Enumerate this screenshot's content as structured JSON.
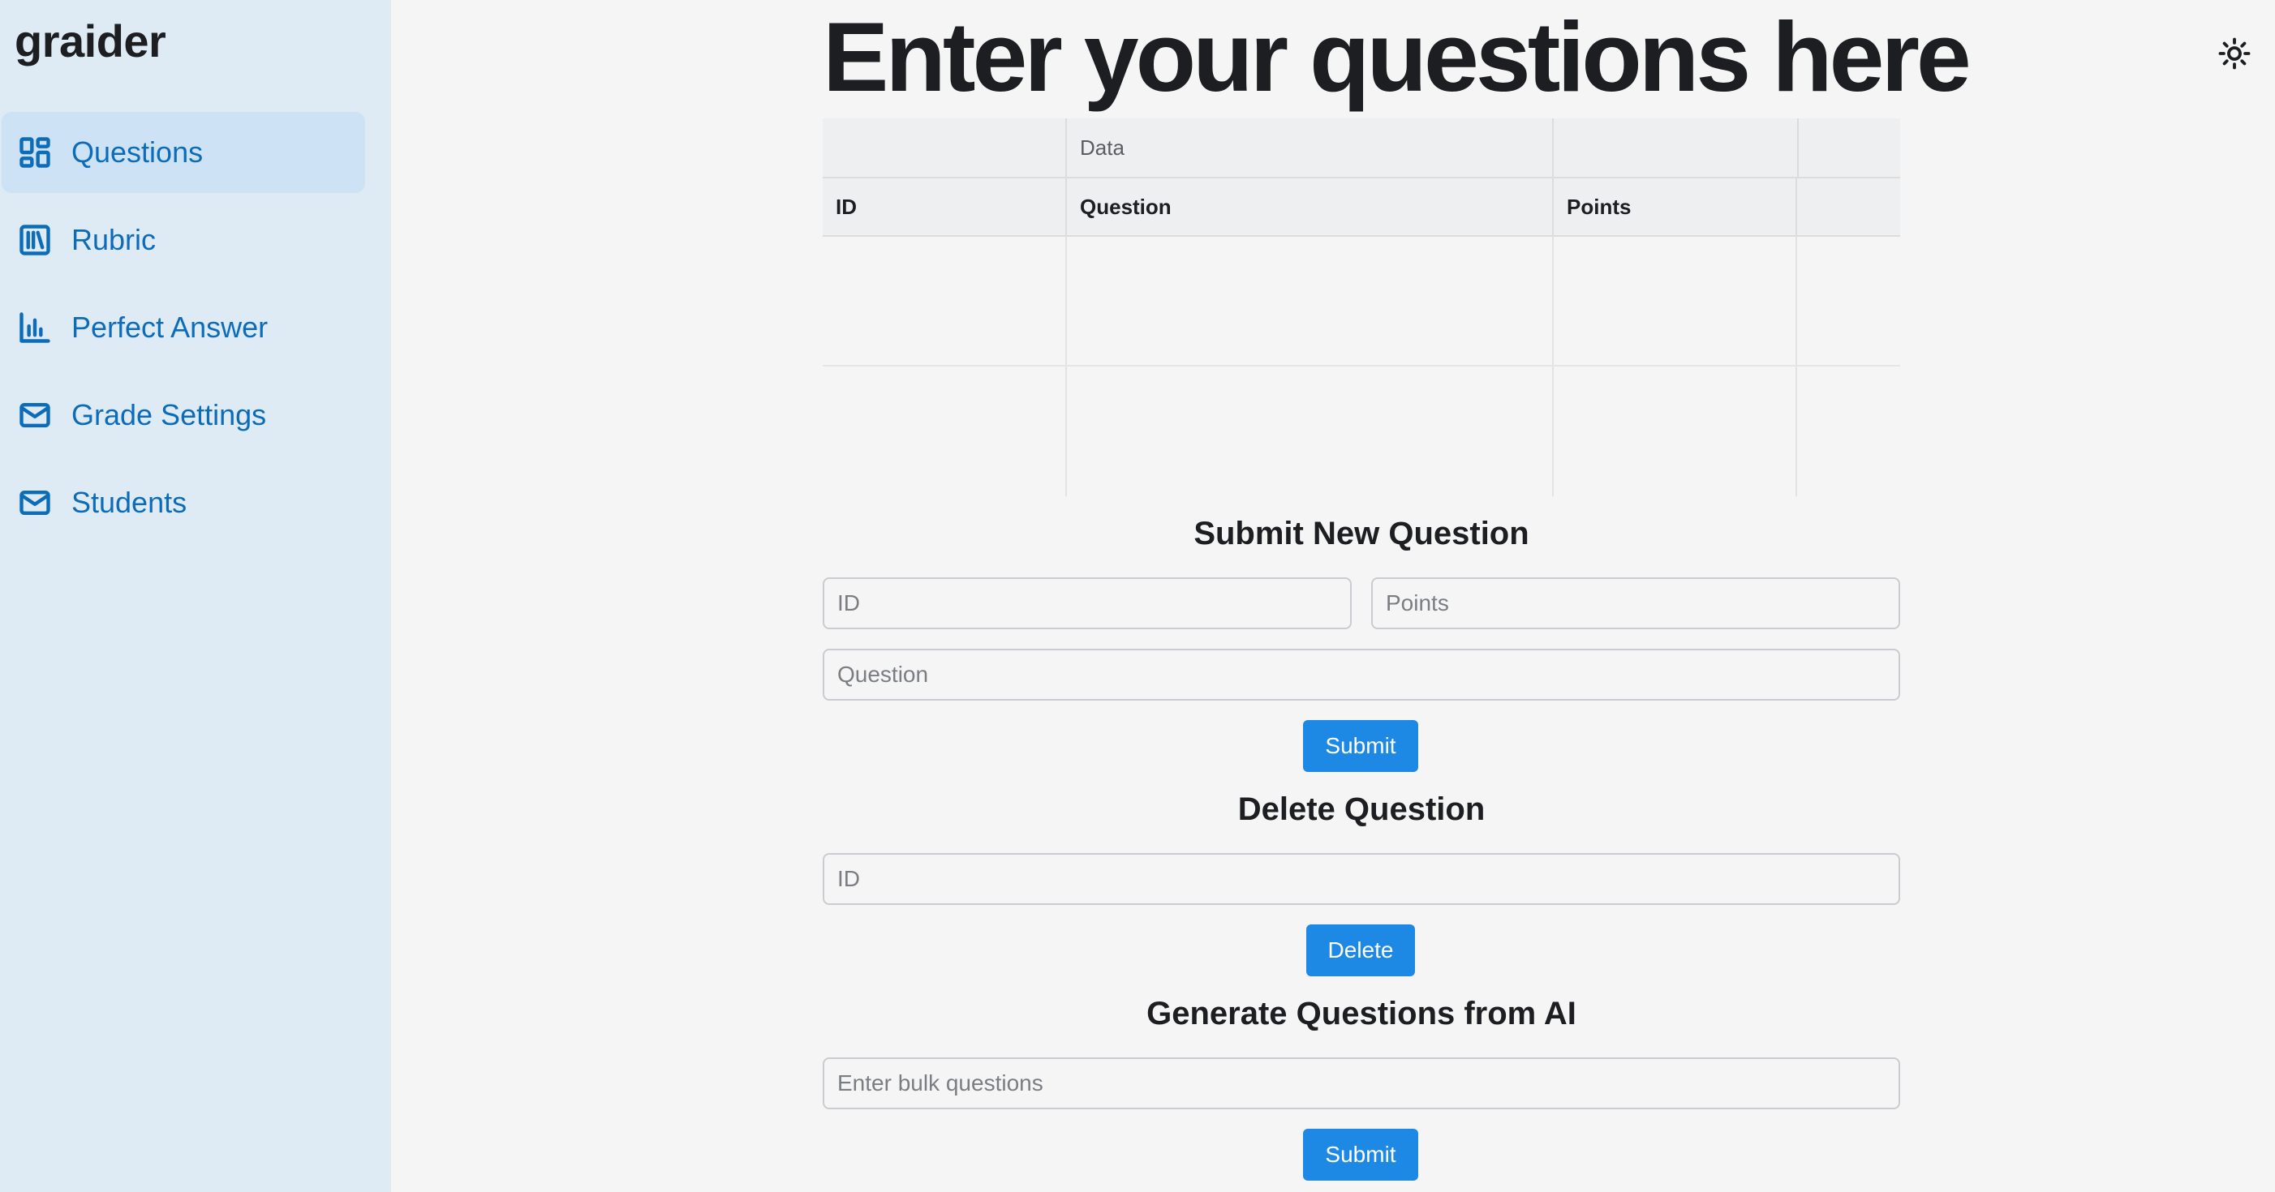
{
  "app": {
    "name": "graider"
  },
  "sidebar": {
    "items": [
      {
        "label": "Questions",
        "icon": "dashboard-icon",
        "active": true
      },
      {
        "label": "Rubric",
        "icon": "library-icon",
        "active": false
      },
      {
        "label": "Perfect Answer",
        "icon": "bar-chart-icon",
        "active": false
      },
      {
        "label": "Grade Settings",
        "icon": "mail-icon",
        "active": false
      },
      {
        "label": "Students",
        "icon": "mail-icon",
        "active": false
      }
    ]
  },
  "header": {
    "theme_toggle_icon": "sun-icon"
  },
  "main": {
    "title": "Enter your questions here",
    "grid": {
      "group_header": "Data",
      "columns": [
        "ID",
        "Question",
        "Points"
      ],
      "rows": []
    },
    "submit_section": {
      "title": "Submit New Question",
      "id_placeholder": "ID",
      "points_placeholder": "Points",
      "question_placeholder": "Question",
      "button_label": "Submit"
    },
    "delete_section": {
      "title": "Delete Question",
      "id_placeholder": "ID",
      "button_label": "Delete"
    },
    "ai_section": {
      "title": "Generate Questions from AI",
      "placeholder": "Enter bulk questions",
      "button_label": "Submit"
    }
  },
  "colors": {
    "sidebar_bg": "#deebf5",
    "active_item_bg": "#cde3f5",
    "accent": "#0c6cba",
    "button": "#1e88e5"
  }
}
